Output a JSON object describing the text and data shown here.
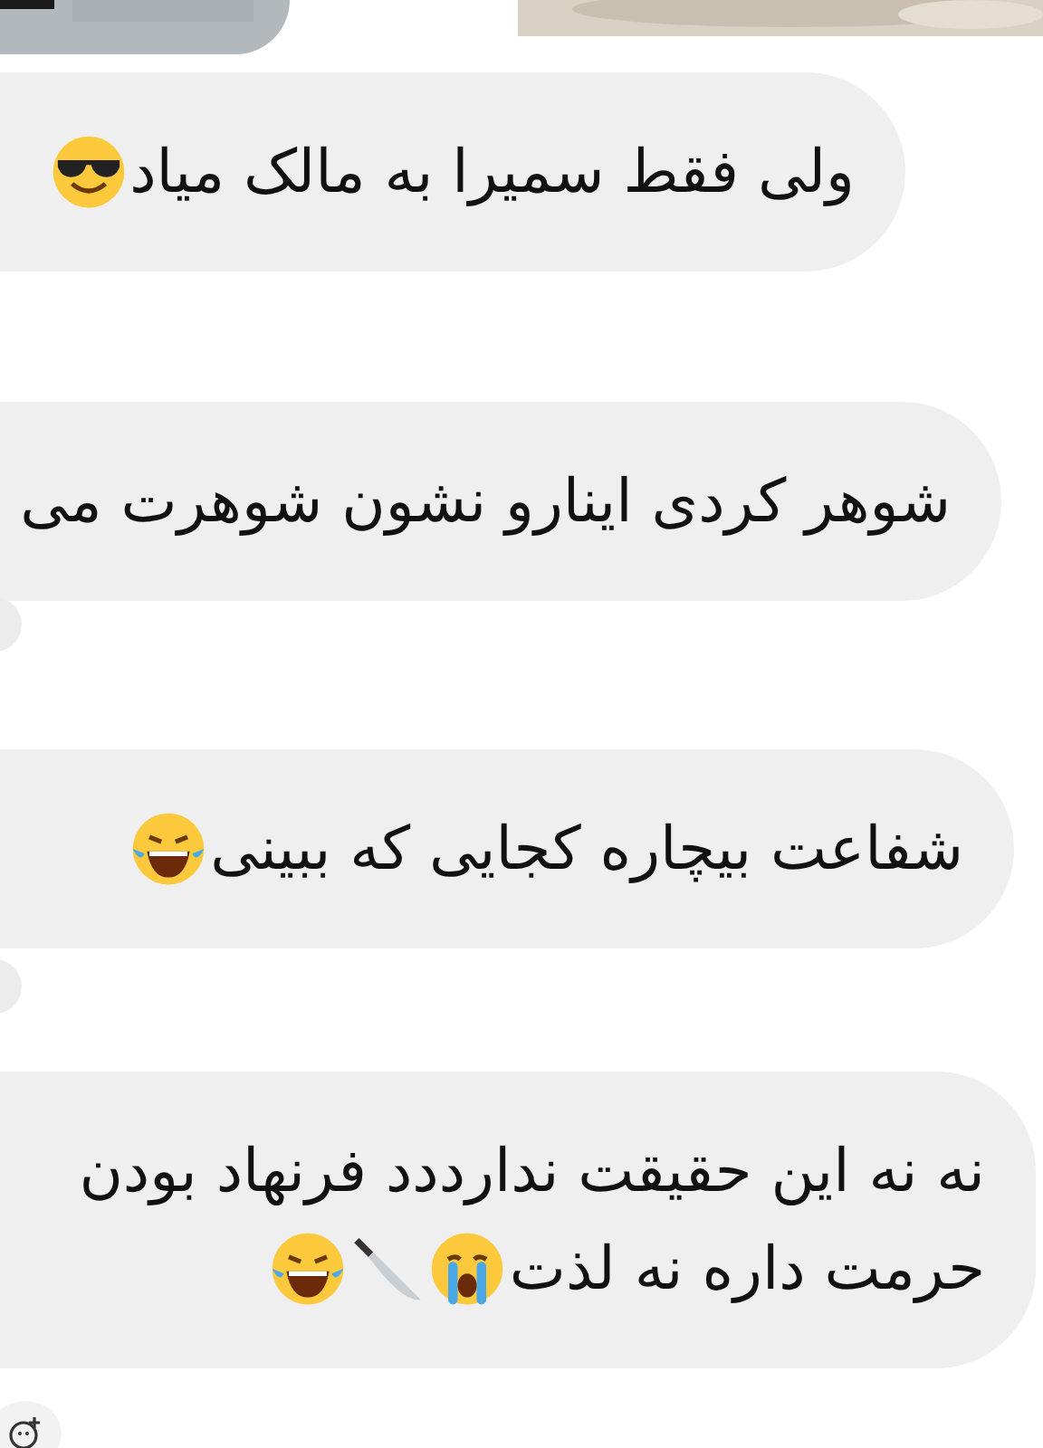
{
  "messages": [
    {
      "lines": [
        "ولی فقط سمیرا به مالک میاد"
      ],
      "emojis": [
        {
          "kind": "sunglasses"
        }
      ]
    },
    {
      "lines": [
        "شوهر کردی اینارو نشون شوهرت می"
      ]
    },
    {
      "lines": [
        "شفاعت بیچاره کجایی که ببینی"
      ],
      "emojis": [
        {
          "kind": "laughing"
        }
      ]
    },
    {
      "lines": [
        "نه نه این حقیقت ندارددد فرنهاد بودن",
        "حرمت داره نه لذت"
      ],
      "emojis": [
        {
          "kind": "crying"
        },
        {
          "kind": "knife"
        },
        {
          "kind": "laughing"
        }
      ]
    }
  ]
}
